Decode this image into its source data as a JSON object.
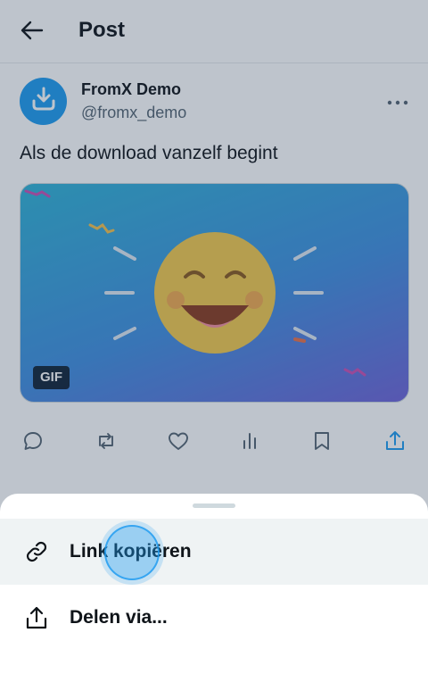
{
  "header": {
    "title": "Post",
    "back_icon": "arrow-left-icon"
  },
  "post": {
    "display_name": "FromX Demo",
    "handle": "@fromx_demo",
    "text": "Als de download vanzelf begint",
    "avatar_icon": "download-icon",
    "more_icon": "more-horizontal-icon",
    "media": {
      "badge": "GIF",
      "content": "smiling-emoji"
    }
  },
  "actions": [
    {
      "name": "reply",
      "icon": "comment-icon"
    },
    {
      "name": "repost",
      "icon": "repost-icon"
    },
    {
      "name": "like",
      "icon": "heart-icon"
    },
    {
      "name": "views",
      "icon": "chart-icon"
    },
    {
      "name": "bookmark",
      "icon": "bookmark-icon"
    },
    {
      "name": "share",
      "icon": "share-icon"
    }
  ],
  "share_sheet": {
    "items": [
      {
        "label": "Link kopiëren",
        "icon": "link-icon"
      },
      {
        "label": "Delen via...",
        "icon": "share-icon"
      }
    ]
  },
  "colors": {
    "accent": "#1d9bf0",
    "text": "#0f1419",
    "muted": "#536471"
  }
}
